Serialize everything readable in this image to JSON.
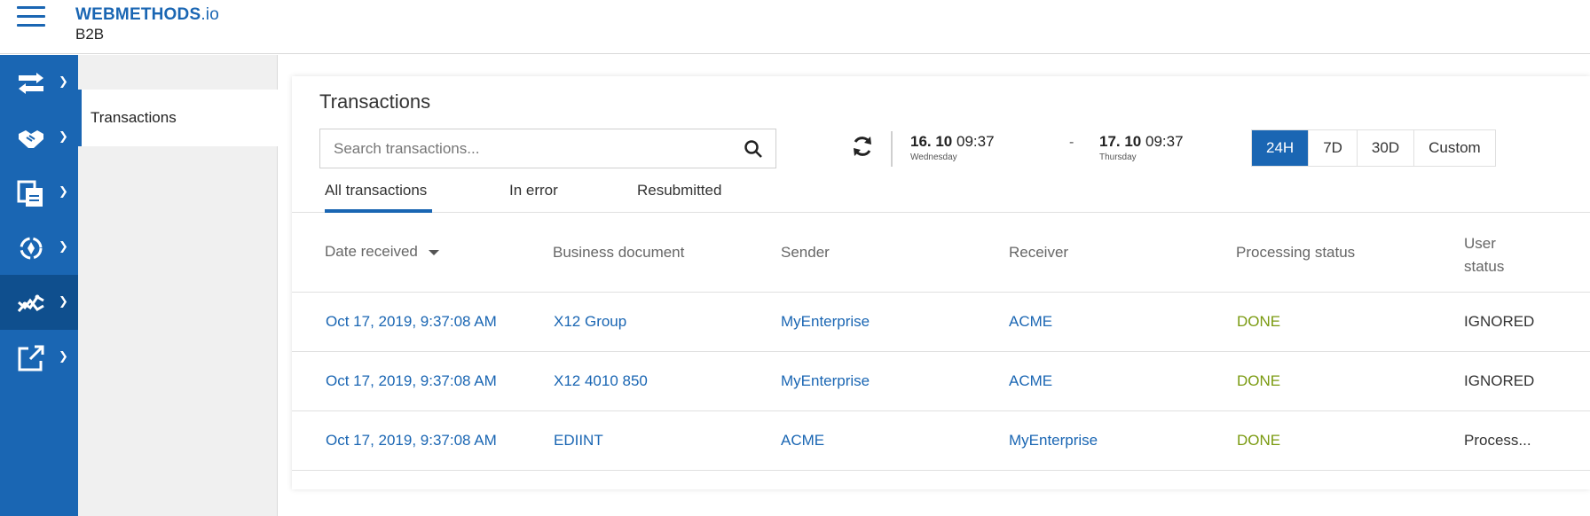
{
  "header": {
    "brand_main": "WEBMETHODS",
    "brand_suffix": ".io",
    "brand_sub": "B2B"
  },
  "colors": {
    "primary": "#1a66b3",
    "rail_active": "#0f4f8e",
    "status_done": "#7a9a10"
  },
  "rail": {
    "items": [
      {
        "icon": "transfer-arrows-icon",
        "active": false
      },
      {
        "icon": "handshake-icon",
        "active": false
      },
      {
        "icon": "documents-icon",
        "active": false
      },
      {
        "icon": "process-cycle-icon",
        "active": false
      },
      {
        "icon": "monitoring-graph-icon",
        "active": true
      },
      {
        "icon": "external-link-icon",
        "active": false
      }
    ]
  },
  "subnav": {
    "items": [
      {
        "label": "Transactions",
        "active": true
      }
    ]
  },
  "page": {
    "title": "Transactions"
  },
  "search": {
    "placeholder": "Search transactions...",
    "value": ""
  },
  "date_range": {
    "from_date": "16. 10",
    "from_time": "09:37",
    "from_day": "Wednesday",
    "separator": "-",
    "to_date": "17. 10",
    "to_time": "09:37",
    "to_day": "Thursday"
  },
  "range_buttons": [
    {
      "label": "24H",
      "active": true
    },
    {
      "label": "7D",
      "active": false
    },
    {
      "label": "30D",
      "active": false
    },
    {
      "label": "Custom",
      "active": false
    }
  ],
  "tabs": [
    {
      "label": "All transactions",
      "active": true
    },
    {
      "label": "In error",
      "active": false
    },
    {
      "label": "Resubmitted",
      "active": false
    }
  ],
  "table": {
    "columns": [
      "Date received",
      "Business document",
      "Sender",
      "Receiver",
      "Processing status",
      "User status"
    ],
    "user_status_line1": "User",
    "user_status_line2": "status",
    "rows": [
      {
        "date": "Oct 17, 2019, 9:37:08 AM",
        "document": "X12 Group",
        "sender": "MyEnterprise",
        "receiver": "ACME",
        "processing": "DONE",
        "user": "IGNORED"
      },
      {
        "date": "Oct 17, 2019, 9:37:08 AM",
        "document": "X12 4010 850",
        "sender": "MyEnterprise",
        "receiver": "ACME",
        "processing": "DONE",
        "user": "IGNORED"
      },
      {
        "date": "Oct 17, 2019, 9:37:08 AM",
        "document": "EDIINT",
        "sender": "ACME",
        "receiver": "MyEnterprise",
        "processing": "DONE",
        "user": "Process..."
      }
    ]
  }
}
